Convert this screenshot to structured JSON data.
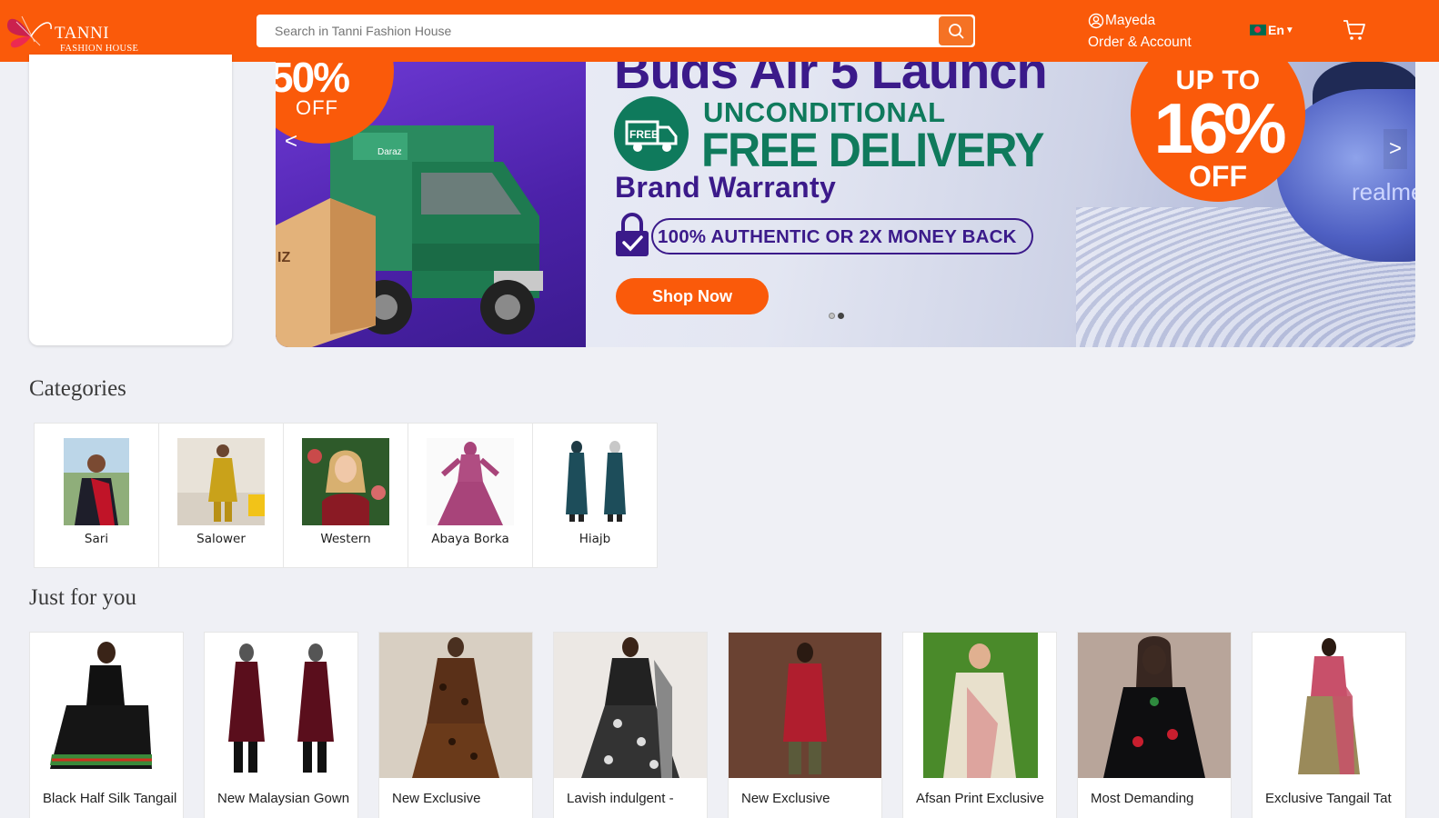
{
  "header": {
    "logo_brand": "TANNI",
    "logo_sub": "FASHION HOUSE",
    "search_placeholder": "Search in Tanni Fashion House",
    "user_name": "Mayeda",
    "account_label": "Order & Account",
    "language": "En",
    "colors": {
      "bar": "#fa5a0a",
      "search_button": "#f57224"
    }
  },
  "banner": {
    "headline": "Buds Air 5 Launch",
    "left_discount": "50%",
    "left_off": "OFF",
    "unconditional": "UNCONDITIONAL",
    "free_delivery": "FREE DELIVERY",
    "free_badge": "FREE",
    "brand_warranty": "Brand Warranty",
    "authentic": "100% AUTHENTIC OR 2X MONEY BACK",
    "shop_now": "Shop Now",
    "up_to": "UP TO",
    "right_discount": "16%",
    "right_off": "OFF",
    "product_brand": "realme",
    "prev_arrow": "<",
    "next_arrow": ">",
    "slide_count": 2,
    "active_slide": 2
  },
  "categories": {
    "title": "Categories",
    "items": [
      {
        "label": "Sari",
        "icon": "sari-photo"
      },
      {
        "label": "Salower",
        "icon": "salower-photo"
      },
      {
        "label": "Western",
        "icon": "western-photo"
      },
      {
        "label": "Abaya Borka",
        "icon": "abaya-photo"
      },
      {
        "label": "Hiajb",
        "icon": "hijab-photo"
      }
    ]
  },
  "just_for_you": {
    "title": "Just for you",
    "products": [
      {
        "title": "Black Half Silk Tangail"
      },
      {
        "title": "New Malaysian Gown"
      },
      {
        "title": "New Exclusive"
      },
      {
        "title": "Lavish indulgent -"
      },
      {
        "title": "New Exclusive"
      },
      {
        "title": "Afsan Print Exclusive"
      },
      {
        "title": "Most Demanding"
      },
      {
        "title": "Exclusive Tangail Tat"
      }
    ]
  }
}
